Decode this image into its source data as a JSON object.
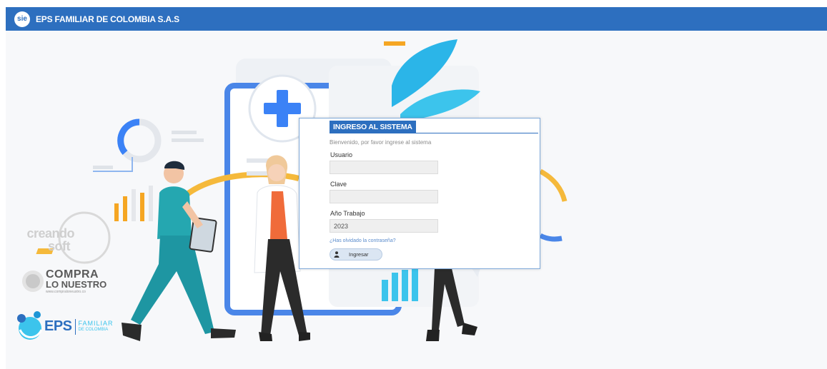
{
  "header": {
    "logo_text": "sie",
    "title": "EPS FAMILIAR DE COLOMBIA S.A.S"
  },
  "login": {
    "heading": "INGRESO AL SISTEMA",
    "welcome": "Bienvenido, por favor ingrese al sistema",
    "usuario_label": "Usuario",
    "usuario_value": "",
    "clave_label": "Clave",
    "clave_value": "",
    "anio_label": "Año Trabajo",
    "anio_value": "2023",
    "forgot_link": "¿Has olvidado la contraseña?",
    "submit_label": "Ingresar",
    "submit_icon": "user-icon"
  },
  "logos": {
    "creando_soft": {
      "line1": "creando",
      "line2": "soft"
    },
    "compra_lo_nuestro": {
      "line1": "COMPRA",
      "line2": "LO NUESTRO",
      "line3": "www.compraloneustro.co"
    },
    "eps_familiar": {
      "main": "EPS",
      "line1": "FAMILIAR",
      "line2": "DE COLOMBIA"
    }
  },
  "colors": {
    "brand_blue": "#2d6fbf",
    "accent_orange": "#f5a623",
    "accent_cyan": "#2bb5e8"
  }
}
